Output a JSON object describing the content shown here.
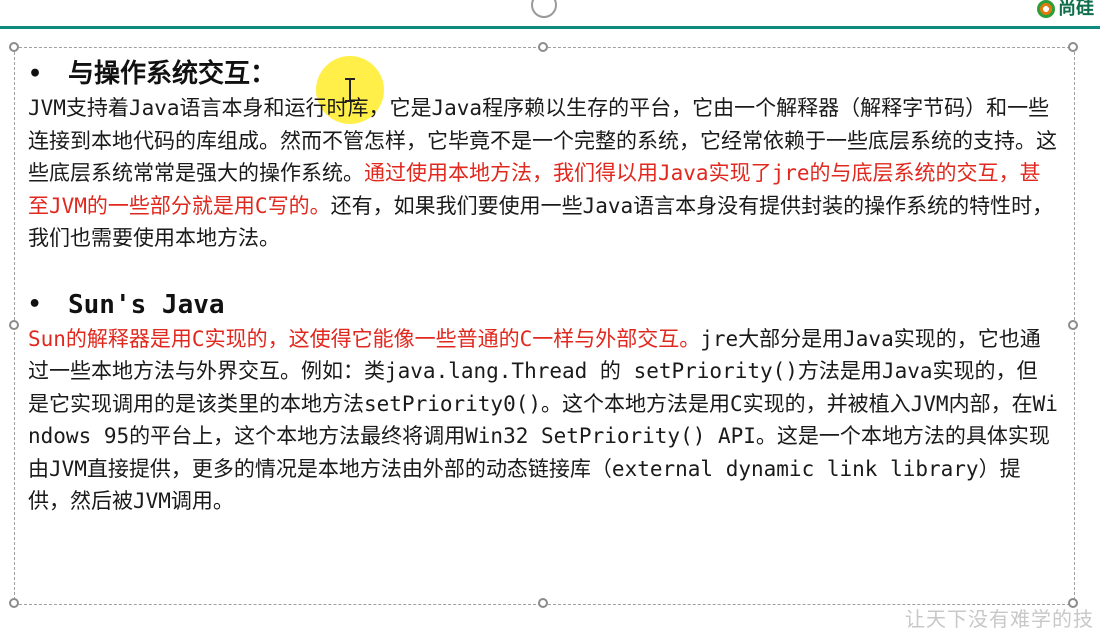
{
  "header": {
    "logo_text": "尚硅"
  },
  "section1": {
    "heading": "与操作系统交互：",
    "para_1": "JVM支持着Java语言本身和运行时库，它是Java程序赖以生存的平台，它由一个解释器（解释字节码）和一些连接到本地代码的库组成。然而不管怎样，它毕竟不是一个完整的系统，它经常依赖于一些底层系统的支持。这些底层系统常常是强大的操作系统。",
    "para_red": "通过使用本地方法，我们得以用Java实现了jre的与底层系统的交互，甚至JVM的一些部分就是用C写的。",
    "para_2": "还有，如果我们要使用一些Java语言本身没有提供封装的操作系统的特性时，我们也需要使用本地方法。"
  },
  "section2": {
    "heading": "Sun's Java",
    "para_red": "Sun的解释器是用C实现的，这使得它能像一些普通的C一样与外部交互。",
    "para_1": "jre大部分是用Java实现的，它也通过一些本地方法与外界交互。例如：类java.lang.Thread 的 setPriority()方法是用Java实现的，但是它实现调用的是该类里的本地方法setPriority0()。这个本地方法是用C实现的，并被植入JVM内部，在Windows 95的平台上，这个本地方法最终将调用Win32 SetPriority() API。这是一个本地方法的具体实现由JVM直接提供，更多的情况是本地方法由外部的动态链接库（external dynamic link library）提供，然后被JVM调用。"
  },
  "watermark": "让天下没有难学的技",
  "colors": {
    "accent": "#0e8a7e",
    "highlight_red": "#e0281e"
  }
}
